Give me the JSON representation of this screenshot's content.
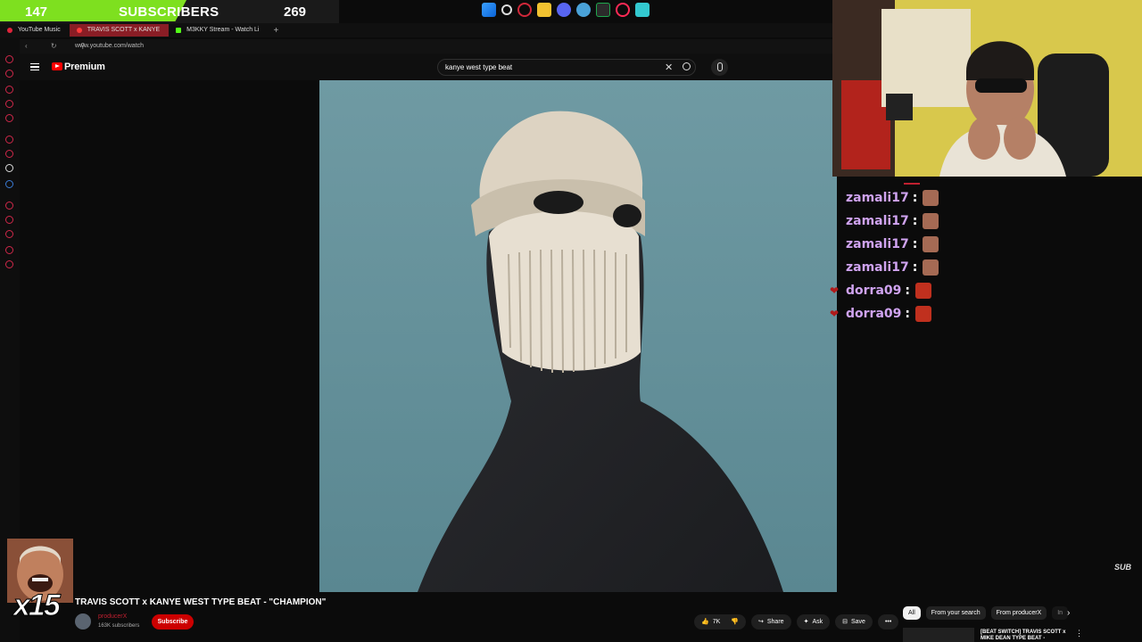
{
  "overlay": {
    "sub_current": "147",
    "sub_label": "SUBSCRIBERS",
    "sub_goal": "269",
    "sub_progress_fraction": 0.55,
    "multiplier": "x15"
  },
  "browser": {
    "tabs": [
      {
        "label": "YouTube Music",
        "active": false,
        "color": "#e0243b"
      },
      {
        "label": "TRAVIS SCOTT x KANYE",
        "active": true,
        "color": "#ff3b3b"
      },
      {
        "label": "M3KKY Stream - Watch Li",
        "active": false,
        "color": "#53fc18"
      }
    ],
    "new_tab_label": "+",
    "url": "www.youtube.com/watch"
  },
  "youtube": {
    "brand": "Premium",
    "search_query": "kanye west type beat",
    "video_title": "TRAVIS SCOTT x KANYE WEST TYPE BEAT - \"CHAMPION\"",
    "channel_name": "producerX",
    "subscriber_count": "163K subscribers",
    "subscribe_label": "Subscribe",
    "like_count": "7K",
    "share_label": "Share",
    "ask_label": "Ask",
    "save_label": "Save",
    "more_label": "•••",
    "chips": [
      "All",
      "From your search",
      "From producerX",
      "In"
    ],
    "reco_title": "[BEAT SWITCH] TRAVIS SCOTT x MIKE DEAN TYPE BEAT -"
  },
  "chat": {
    "messages": [
      {
        "user": "zamali17",
        "badge": false
      },
      {
        "user": "zamali17",
        "badge": false
      },
      {
        "user": "zamali17",
        "badge": false
      },
      {
        "user": "zamali17",
        "badge": false
      },
      {
        "user": "dorra09",
        "badge": true
      },
      {
        "user": "dorra09",
        "badge": true
      }
    ],
    "separator": ":"
  },
  "stream_badge": "SUB"
}
